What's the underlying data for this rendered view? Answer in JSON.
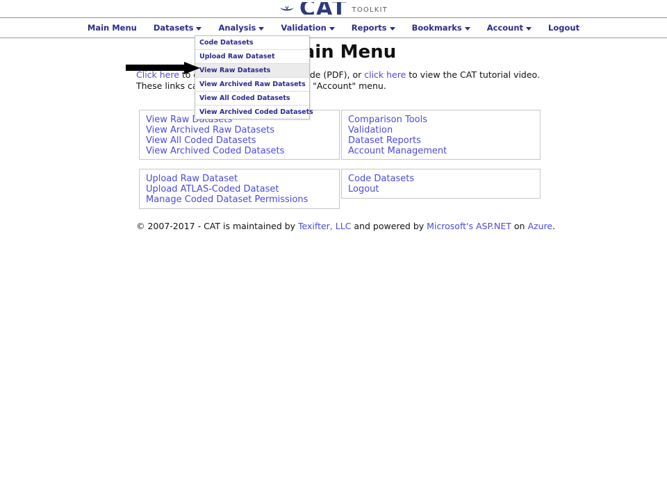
{
  "brand": {
    "name": "CAT",
    "subtitle": "TOOLKIT",
    "icon": "bird-logo-icon",
    "color": "#2b3a7a"
  },
  "nav": {
    "items": [
      {
        "label": "Main Menu",
        "has_caret": false
      },
      {
        "label": "Datasets",
        "has_caret": true
      },
      {
        "label": "Analysis",
        "has_caret": true
      },
      {
        "label": "Validation",
        "has_caret": true
      },
      {
        "label": "Reports",
        "has_caret": true
      },
      {
        "label": "Bookmarks",
        "has_caret": true
      },
      {
        "label": "Account",
        "has_caret": true
      },
      {
        "label": "Logout",
        "has_caret": false
      }
    ]
  },
  "dropdown": {
    "parent": "Datasets",
    "items": [
      {
        "label": "Code Datasets",
        "active": false
      },
      {
        "label": "Upload Raw Dataset",
        "active": false
      },
      {
        "label": "View Raw Datasets",
        "active": true
      },
      {
        "label": "View Archived Raw Datasets",
        "active": false
      },
      {
        "label": "View All Coded Datasets",
        "active": false
      },
      {
        "label": "View Archived Coded Datasets",
        "active": false
      }
    ]
  },
  "page": {
    "title": "Main Menu"
  },
  "intro": {
    "line1_a": "Click here",
    "line1_b": " to download the CAT user guide (PDF), or ",
    "line1_c": "click here",
    "line1_d": " to view the CAT tutorial video.",
    "line2": "These links can also be found under the \"Account\" menu."
  },
  "annotation": {
    "type": "arrow",
    "direction": "right",
    "color": "#000000",
    "points_to": "View Raw Datasets"
  },
  "panels": [
    {
      "id": "panel-tl",
      "links": [
        "View Raw Datasets",
        "View Archived Raw Datasets",
        "View All Coded Datasets",
        "View Archived Coded Datasets"
      ]
    },
    {
      "id": "panel-tr",
      "links": [
        "Comparison Tools",
        "Validation",
        "Dataset Reports",
        "Account Management"
      ]
    },
    {
      "id": "panel-bl",
      "links": [
        "Upload Raw Dataset",
        "Upload ATLAS-Coded Dataset",
        "Manage Coded Dataset Permissions"
      ]
    },
    {
      "id": "panel-br",
      "links": [
        "Code Datasets",
        "Logout"
      ]
    }
  ],
  "footer": {
    "copyright": "© 2007-2017 - CAT is maintained by ",
    "link1": "Texifter, LLC",
    "mid": " and powered by ",
    "link2": "Microsoft's ASP.NET",
    "mid2": " on ",
    "link3": "Azure",
    "end": "."
  },
  "colors": {
    "link": "#4a4ae0",
    "nav_text": "#2b2b8f",
    "panel_border": "#c6c6c6",
    "dropdown_highlight": "#ebebeb"
  }
}
